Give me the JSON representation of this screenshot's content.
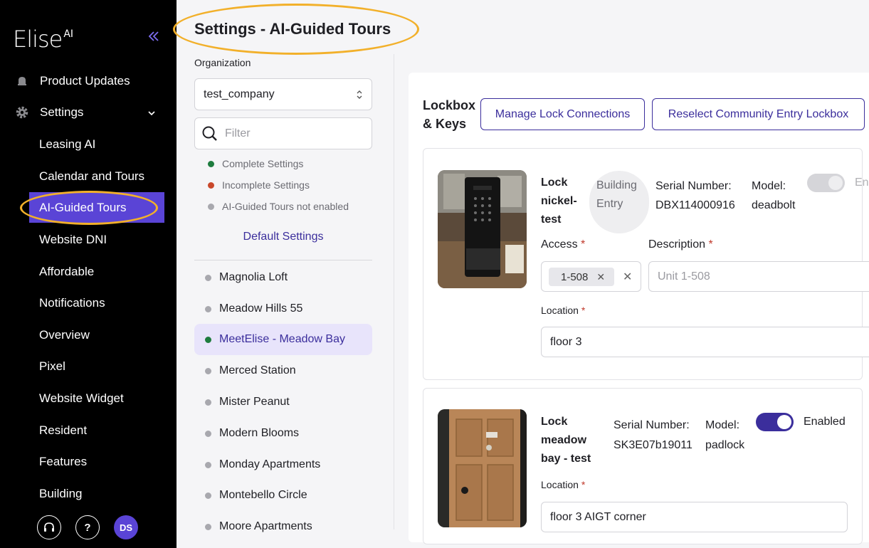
{
  "brand": {
    "logo_text": "Elise",
    "logo_suffix": "AI"
  },
  "sidebar": {
    "product_updates": "Product Updates",
    "settings": "Settings",
    "items": [
      {
        "label": "Leasing AI"
      },
      {
        "label": "Calendar and Tours"
      },
      {
        "label": "AI-Guided Tours"
      },
      {
        "label": "Website DNI"
      },
      {
        "label": "Affordable"
      },
      {
        "label": "Notifications"
      },
      {
        "label": "Overview"
      },
      {
        "label": "Pixel"
      },
      {
        "label": "Website Widget"
      },
      {
        "label": "Resident"
      },
      {
        "label": "Features"
      },
      {
        "label": "Building"
      }
    ],
    "help_label": "?",
    "avatar_initials": "DS"
  },
  "header": {
    "title": "Settings - AI-Guided Tours"
  },
  "organization": {
    "label": "Organization",
    "selected": "test_company",
    "filter_placeholder": "Filter"
  },
  "legend": [
    {
      "label": "Complete Settings",
      "color": "#1e7c3e"
    },
    {
      "label": "Incomplete Settings",
      "color": "#c9482b"
    },
    {
      "label": "AI-Guided Tours not enabled",
      "color": "#a8a8ae"
    }
  ],
  "default_settings": "Default Settings",
  "properties": [
    {
      "name": "Magnolia Loft"
    },
    {
      "name": "Meadow Hills 55"
    },
    {
      "name": "MeetElise - Meadow Bay"
    },
    {
      "name": "Merced Station"
    },
    {
      "name": "Mister Peanut"
    },
    {
      "name": "Modern Blooms"
    },
    {
      "name": "Monday Apartments"
    },
    {
      "name": "Montebello Circle"
    },
    {
      "name": "Moore Apartments"
    }
  ],
  "lockbox": {
    "title_line1": "Lockbox",
    "title_line2": "& Keys",
    "manage_button": "Manage Lock Connections",
    "reselect_button": "Reselect Community Entry Lockbox",
    "locks": [
      {
        "name_lines": [
          "Lock",
          "nickel-",
          "test"
        ],
        "tag_line1": "Building",
        "tag_line2": "Entry",
        "serial_label": "Serial Number:",
        "serial": "DBX114000916",
        "model_label": "Model:",
        "model": "deadbolt",
        "enabled_label": "En",
        "enabled": false,
        "access_label": "Access",
        "access_value": "1-508",
        "description_label": "Description",
        "description_placeholder": "Unit 1-508",
        "location_label": "Location",
        "location_value": "floor 3"
      },
      {
        "name_lines": [
          "Lock",
          "meadow",
          "bay - test"
        ],
        "serial_label": "Serial Number:",
        "serial": "SK3E07b19011",
        "model_label": "Model:",
        "model": "padlock",
        "enabled_label": "Enabled",
        "enabled": true,
        "location_label": "Location",
        "location_value": "floor 3 AIGT corner"
      }
    ]
  },
  "required_mark": "*",
  "colors": {
    "accent": "#5a44d6",
    "link": "#3b2e9c",
    "highlight_ring": "#f2b02a",
    "selected_row_bg": "#e8e4fb"
  }
}
